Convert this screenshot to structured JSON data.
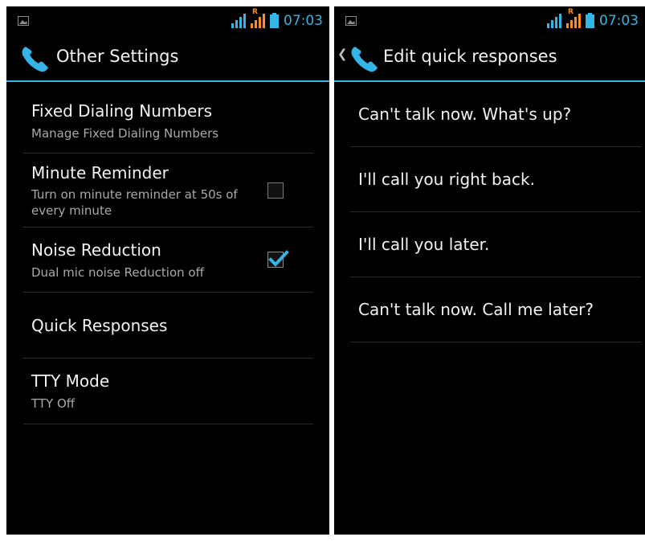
{
  "status": {
    "time": "07:03",
    "roaming": "R"
  },
  "accent": "#33b5e5",
  "left": {
    "title": "Other Settings",
    "prefs": [
      {
        "title": "Fixed Dialing Numbers",
        "summary": "Manage Fixed Dialing Numbers"
      },
      {
        "title": "Minute Reminder",
        "summary": "Turn on minute reminder at 50s of every minute",
        "checked": false
      },
      {
        "title": "Noise Reduction",
        "summary": "Dual mic noise Reduction off",
        "checked": true
      },
      {
        "title": "Quick Responses"
      },
      {
        "title": "TTY Mode",
        "summary": "TTY Off"
      }
    ]
  },
  "right": {
    "title": "Edit quick responses",
    "responses": [
      "Can't talk now. What's up?",
      "I'll call you right back.",
      "I'll call you later.",
      "Can't talk now. Call me later?"
    ]
  },
  "icons": [
    "gallery-icon",
    "signal-icon",
    "roaming-signal-icon",
    "battery-icon",
    "phone-icon",
    "up-caret-icon",
    "checkbox-icon",
    "checkmark-icon"
  ]
}
